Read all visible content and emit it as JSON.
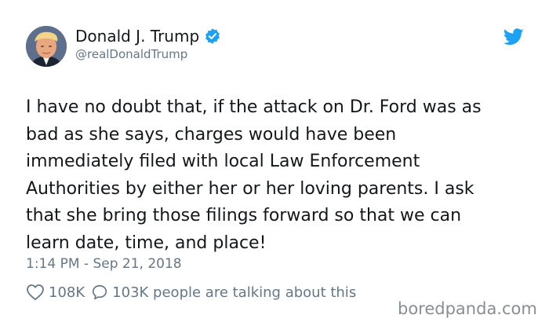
{
  "tweet": {
    "author": {
      "display_name": "Donald J. Trump",
      "handle": "@realDonaldTrump",
      "verified_icon": "verified-badge-icon",
      "avatar_icon": "avatar-photo"
    },
    "brand_icon": "twitter-bird-icon",
    "text": "I have no doubt that, if the attack on Dr. Ford was as\nbad as she says, charges would have been\nimmediately filed with local Law Enforcement\nAuthorities by either her or her loving parents. I ask\nthat she bring those filings forward so that we can\nlearn  date, time, and place!",
    "timestamp": "1:14 PM - Sep 21, 2018",
    "likes": "108K",
    "talking": "103K people are talking about this"
  },
  "watermark": "boredpanda.com",
  "colors": {
    "text": "#14171a",
    "muted": "#657786",
    "twitter_blue": "#1da1f2",
    "watermark": "#8a8d91"
  }
}
